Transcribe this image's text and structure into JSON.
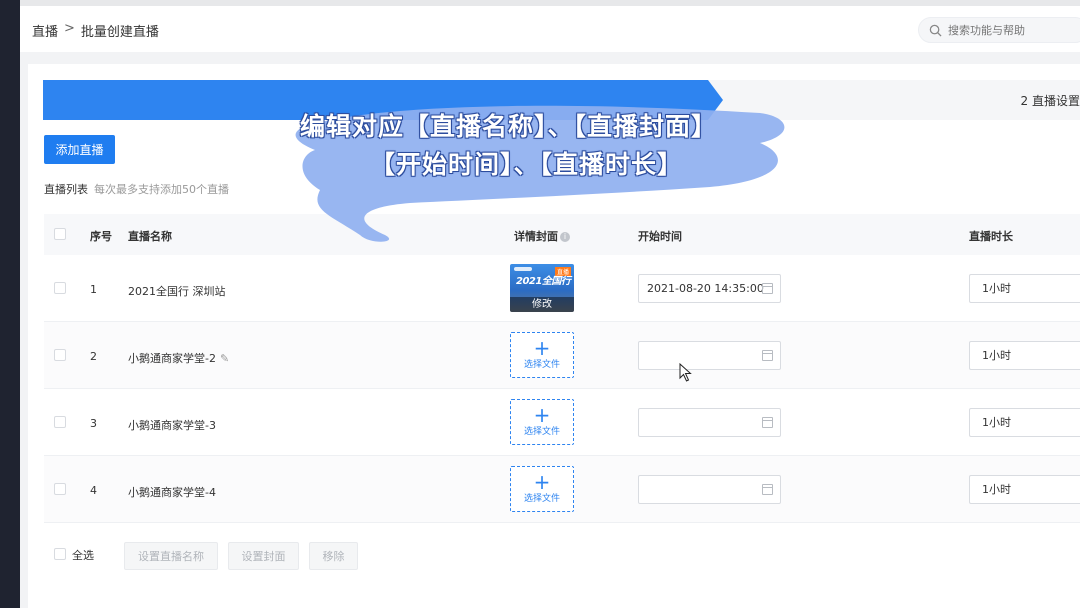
{
  "breadcrumb": {
    "root": "直播",
    "sep": ">",
    "current": "批量创建直播"
  },
  "search": {
    "placeholder": "搜索功能与帮助"
  },
  "steps": {
    "step2": "2 直播设置"
  },
  "toolbar": {
    "add_label": "添加直播"
  },
  "list": {
    "title": "直播列表",
    "hint": "每次最多支持添加50个直播"
  },
  "table": {
    "headers": {
      "index": "序号",
      "name": "直播名称",
      "cover": "详情封面",
      "start": "开始时间",
      "duration": "直播时长"
    },
    "rows": [
      {
        "index": "1",
        "name": "2021全国行 深圳站",
        "cover_text": "2021全国行",
        "cover_badge": "直播",
        "cover_edit": "修改",
        "start": "2021-08-20 14:35:00",
        "duration": "1小时"
      },
      {
        "index": "2",
        "name": "小鹅通商家学堂-2",
        "upload_label": "选择文件",
        "start": "",
        "duration": "1小时"
      },
      {
        "index": "3",
        "name": "小鹅通商家学堂-3",
        "upload_label": "选择文件",
        "start": "",
        "duration": "1小时"
      },
      {
        "index": "4",
        "name": "小鹅通商家学堂-4",
        "upload_label": "选择文件",
        "start": "",
        "duration": "1小时"
      }
    ]
  },
  "footer": {
    "select_all": "全选",
    "set_name": "设置直播名称",
    "set_cover": "设置封面",
    "remove": "移除"
  },
  "overlay": {
    "line1": "编辑对应【直播名称】、【直播封面】",
    "line2": "【开始时间】、【直播时长】"
  },
  "colors": {
    "primary": "#1f7df0",
    "brush": "#8fb0f0"
  }
}
